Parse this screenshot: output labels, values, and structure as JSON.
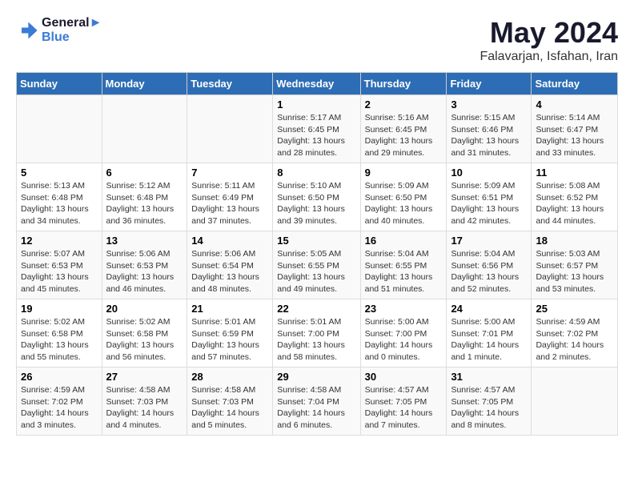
{
  "header": {
    "logo_line1": "General",
    "logo_line2": "Blue",
    "month": "May 2024",
    "location": "Falavarjan, Isfahan, Iran"
  },
  "weekdays": [
    "Sunday",
    "Monday",
    "Tuesday",
    "Wednesday",
    "Thursday",
    "Friday",
    "Saturday"
  ],
  "weeks": [
    [
      {
        "day": "",
        "info": ""
      },
      {
        "day": "",
        "info": ""
      },
      {
        "day": "",
        "info": ""
      },
      {
        "day": "1",
        "info": "Sunrise: 5:17 AM\nSunset: 6:45 PM\nDaylight: 13 hours\nand 28 minutes."
      },
      {
        "day": "2",
        "info": "Sunrise: 5:16 AM\nSunset: 6:45 PM\nDaylight: 13 hours\nand 29 minutes."
      },
      {
        "day": "3",
        "info": "Sunrise: 5:15 AM\nSunset: 6:46 PM\nDaylight: 13 hours\nand 31 minutes."
      },
      {
        "day": "4",
        "info": "Sunrise: 5:14 AM\nSunset: 6:47 PM\nDaylight: 13 hours\nand 33 minutes."
      }
    ],
    [
      {
        "day": "5",
        "info": "Sunrise: 5:13 AM\nSunset: 6:48 PM\nDaylight: 13 hours\nand 34 minutes."
      },
      {
        "day": "6",
        "info": "Sunrise: 5:12 AM\nSunset: 6:48 PM\nDaylight: 13 hours\nand 36 minutes."
      },
      {
        "day": "7",
        "info": "Sunrise: 5:11 AM\nSunset: 6:49 PM\nDaylight: 13 hours\nand 37 minutes."
      },
      {
        "day": "8",
        "info": "Sunrise: 5:10 AM\nSunset: 6:50 PM\nDaylight: 13 hours\nand 39 minutes."
      },
      {
        "day": "9",
        "info": "Sunrise: 5:09 AM\nSunset: 6:50 PM\nDaylight: 13 hours\nand 40 minutes."
      },
      {
        "day": "10",
        "info": "Sunrise: 5:09 AM\nSunset: 6:51 PM\nDaylight: 13 hours\nand 42 minutes."
      },
      {
        "day": "11",
        "info": "Sunrise: 5:08 AM\nSunset: 6:52 PM\nDaylight: 13 hours\nand 44 minutes."
      }
    ],
    [
      {
        "day": "12",
        "info": "Sunrise: 5:07 AM\nSunset: 6:53 PM\nDaylight: 13 hours\nand 45 minutes."
      },
      {
        "day": "13",
        "info": "Sunrise: 5:06 AM\nSunset: 6:53 PM\nDaylight: 13 hours\nand 46 minutes."
      },
      {
        "day": "14",
        "info": "Sunrise: 5:06 AM\nSunset: 6:54 PM\nDaylight: 13 hours\nand 48 minutes."
      },
      {
        "day": "15",
        "info": "Sunrise: 5:05 AM\nSunset: 6:55 PM\nDaylight: 13 hours\nand 49 minutes."
      },
      {
        "day": "16",
        "info": "Sunrise: 5:04 AM\nSunset: 6:55 PM\nDaylight: 13 hours\nand 51 minutes."
      },
      {
        "day": "17",
        "info": "Sunrise: 5:04 AM\nSunset: 6:56 PM\nDaylight: 13 hours\nand 52 minutes."
      },
      {
        "day": "18",
        "info": "Sunrise: 5:03 AM\nSunset: 6:57 PM\nDaylight: 13 hours\nand 53 minutes."
      }
    ],
    [
      {
        "day": "19",
        "info": "Sunrise: 5:02 AM\nSunset: 6:58 PM\nDaylight: 13 hours\nand 55 minutes."
      },
      {
        "day": "20",
        "info": "Sunrise: 5:02 AM\nSunset: 6:58 PM\nDaylight: 13 hours\nand 56 minutes."
      },
      {
        "day": "21",
        "info": "Sunrise: 5:01 AM\nSunset: 6:59 PM\nDaylight: 13 hours\nand 57 minutes."
      },
      {
        "day": "22",
        "info": "Sunrise: 5:01 AM\nSunset: 7:00 PM\nDaylight: 13 hours\nand 58 minutes."
      },
      {
        "day": "23",
        "info": "Sunrise: 5:00 AM\nSunset: 7:00 PM\nDaylight: 14 hours\nand 0 minutes."
      },
      {
        "day": "24",
        "info": "Sunrise: 5:00 AM\nSunset: 7:01 PM\nDaylight: 14 hours\nand 1 minute."
      },
      {
        "day": "25",
        "info": "Sunrise: 4:59 AM\nSunset: 7:02 PM\nDaylight: 14 hours\nand 2 minutes."
      }
    ],
    [
      {
        "day": "26",
        "info": "Sunrise: 4:59 AM\nSunset: 7:02 PM\nDaylight: 14 hours\nand 3 minutes."
      },
      {
        "day": "27",
        "info": "Sunrise: 4:58 AM\nSunset: 7:03 PM\nDaylight: 14 hours\nand 4 minutes."
      },
      {
        "day": "28",
        "info": "Sunrise: 4:58 AM\nSunset: 7:03 PM\nDaylight: 14 hours\nand 5 minutes."
      },
      {
        "day": "29",
        "info": "Sunrise: 4:58 AM\nSunset: 7:04 PM\nDaylight: 14 hours\nand 6 minutes."
      },
      {
        "day": "30",
        "info": "Sunrise: 4:57 AM\nSunset: 7:05 PM\nDaylight: 14 hours\nand 7 minutes."
      },
      {
        "day": "31",
        "info": "Sunrise: 4:57 AM\nSunset: 7:05 PM\nDaylight: 14 hours\nand 8 minutes."
      },
      {
        "day": "",
        "info": ""
      }
    ]
  ]
}
